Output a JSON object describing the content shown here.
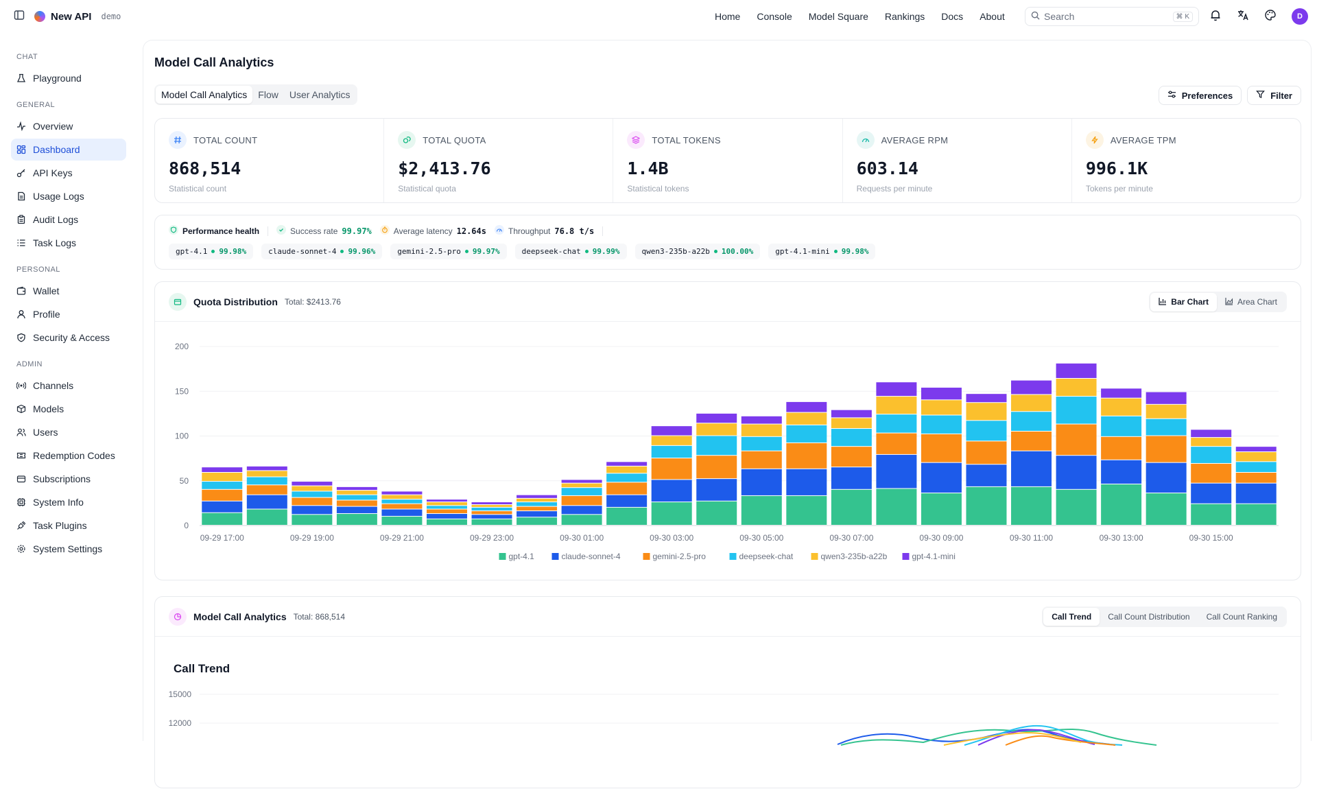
{
  "topbar": {
    "brand": "New API",
    "badge": "demo",
    "nav": [
      "Home",
      "Console",
      "Model Square",
      "Rankings",
      "Docs",
      "About"
    ],
    "search_placeholder": "Search",
    "search_shortcut": "⌘ K",
    "avatar_letter": "D"
  },
  "sidebar": {
    "sections": [
      {
        "title": "CHAT",
        "items": [
          {
            "label": "Playground",
            "icon": "flask-icon"
          }
        ]
      },
      {
        "title": "GENERAL",
        "items": [
          {
            "label": "Overview",
            "icon": "activity-icon"
          },
          {
            "label": "Dashboard",
            "icon": "grid-icon",
            "active": true
          },
          {
            "label": "API Keys",
            "icon": "key-icon"
          },
          {
            "label": "Usage Logs",
            "icon": "file-icon"
          },
          {
            "label": "Audit Logs",
            "icon": "clipboard-icon"
          },
          {
            "label": "Task Logs",
            "icon": "list-icon"
          }
        ]
      },
      {
        "title": "PERSONAL",
        "items": [
          {
            "label": "Wallet",
            "icon": "wallet-icon"
          },
          {
            "label": "Profile",
            "icon": "user-icon"
          },
          {
            "label": "Security & Access",
            "icon": "shield-icon"
          }
        ]
      },
      {
        "title": "ADMIN",
        "items": [
          {
            "label": "Channels",
            "icon": "radio-icon"
          },
          {
            "label": "Models",
            "icon": "box-icon"
          },
          {
            "label": "Users",
            "icon": "users-icon"
          },
          {
            "label": "Redemption Codes",
            "icon": "ticket-icon"
          },
          {
            "label": "Subscriptions",
            "icon": "card-icon"
          },
          {
            "label": "System Info",
            "icon": "cpu-icon"
          },
          {
            "label": "Task Plugins",
            "icon": "plug-icon"
          },
          {
            "label": "System Settings",
            "icon": "gear-icon"
          }
        ]
      }
    ]
  },
  "page": {
    "title": "Model Call Analytics",
    "tabs": [
      "Model Call Analytics",
      "Flow",
      "User Analytics"
    ],
    "preferences_label": "Preferences",
    "filter_label": "Filter"
  },
  "stats": [
    {
      "label": "TOTAL COUNT",
      "value": "868,514",
      "sub": "Statistical count",
      "icon": "hash-icon",
      "color": "#3b82f6",
      "bg": "#eaf2ff"
    },
    {
      "label": "TOTAL QUOTA",
      "value": "$2,413.76",
      "sub": "Statistical quota",
      "icon": "coins-icon",
      "color": "#10b981",
      "bg": "#e6f7f0"
    },
    {
      "label": "TOTAL TOKENS",
      "value": "1.4B",
      "sub": "Statistical tokens",
      "icon": "layers-icon",
      "color": "#d946ef",
      "bg": "#fbeafd"
    },
    {
      "label": "AVERAGE RPM",
      "value": "603.14",
      "sub": "Requests per minute",
      "icon": "gauge-icon",
      "color": "#14b8a6",
      "bg": "#e6f6f5"
    },
    {
      "label": "AVERAGE TPM",
      "value": "996.1K",
      "sub": "Tokens per minute",
      "icon": "bolt-icon",
      "color": "#f59e0b",
      "bg": "#fdf4e3"
    }
  ],
  "performance": {
    "title": "Performance health",
    "success_label": "Success rate",
    "success_value": "99.97%",
    "latency_label": "Average latency",
    "latency_value": "12.64s",
    "throughput_label": "Throughput",
    "throughput_value": "76.8 t/s",
    "models": [
      {
        "name": "gpt-4.1",
        "pct": "99.98%"
      },
      {
        "name": "claude-sonnet-4",
        "pct": "99.96%"
      },
      {
        "name": "gemini-2.5-pro",
        "pct": "99.97%"
      },
      {
        "name": "deepseek-chat",
        "pct": "99.99%"
      },
      {
        "name": "qwen3-235b-a22b",
        "pct": "100.00%"
      },
      {
        "name": "gpt-4.1-mini",
        "pct": "99.98%"
      }
    ]
  },
  "quota": {
    "title": "Quota Distribution",
    "total": "Total: $2413.76",
    "bar_label": "Bar Chart",
    "area_label": "Area Chart"
  },
  "analytics": {
    "title": "Model Call Analytics",
    "total": "Total: 868,514",
    "tabs": [
      "Call Trend",
      "Call Count Distribution",
      "Call Count Ranking"
    ],
    "chart_title": "Call Trend"
  },
  "chart_data": [
    {
      "type": "bar",
      "stacked": true,
      "ylim": [
        0,
        200
      ],
      "yticks": [
        0,
        50,
        100,
        150,
        200
      ],
      "xtick_labels": [
        "09-29 17:00",
        "09-29 19:00",
        "09-29 21:00",
        "09-29 23:00",
        "09-30 01:00",
        "09-30 03:00",
        "09-30 05:00",
        "09-30 07:00",
        "09-30 09:00",
        "09-30 11:00",
        "09-30 13:00",
        "09-30 15:00"
      ],
      "grid": true,
      "legend": "bottom",
      "categories": [
        "09-29 17:00",
        "09-29 18:00",
        "09-29 19:00",
        "09-29 20:00",
        "09-29 21:00",
        "09-29 22:00",
        "09-29 23:00",
        "09-30 00:00",
        "09-30 01:00",
        "09-30 02:00",
        "09-30 03:00",
        "09-30 04:00",
        "09-30 05:00",
        "09-30 06:00",
        "09-30 07:00",
        "09-30 08:00",
        "09-30 09:00",
        "09-30 10:00",
        "09-30 11:00",
        "09-30 12:00",
        "09-30 13:00",
        "09-30 14:00",
        "09-30 15:00",
        "09-30 16:00"
      ],
      "series": [
        {
          "name": "gpt-4.1",
          "color": "#34c38f",
          "values": [
            14,
            18,
            12,
            13,
            10,
            7,
            7,
            9,
            12,
            20,
            26,
            27,
            33,
            33,
            40,
            41,
            36,
            43,
            43,
            40,
            46,
            36,
            24,
            24
          ]
        },
        {
          "name": "claude-sonnet-4",
          "color": "#1d5bea",
          "values": [
            13,
            16,
            10,
            8,
            8,
            6,
            5,
            7,
            10,
            14,
            25,
            25,
            30,
            30,
            25,
            38,
            34,
            25,
            40,
            38,
            27,
            34,
            23,
            23
          ]
        },
        {
          "name": "gemini-2.5-pro",
          "color": "#fa8c16",
          "values": [
            13,
            11,
            9,
            7,
            6,
            5,
            4,
            5,
            11,
            14,
            24,
            26,
            20,
            29,
            23,
            24,
            32,
            26,
            22,
            35,
            26,
            30,
            22,
            12
          ]
        },
        {
          "name": "deepseek-chat",
          "color": "#22c3f0",
          "values": [
            9,
            9,
            7,
            6,
            5,
            4,
            4,
            5,
            9,
            10,
            14,
            22,
            16,
            20,
            20,
            21,
            21,
            23,
            22,
            31,
            23,
            19,
            19,
            12
          ]
        },
        {
          "name": "qwen3-235b-a22b",
          "color": "#fbc02d",
          "values": [
            10,
            7,
            6,
            5,
            5,
            4,
            3,
            4,
            5,
            8,
            11,
            14,
            14,
            14,
            12,
            20,
            17,
            20,
            19,
            20,
            20,
            16,
            10,
            11
          ]
        },
        {
          "name": "gpt-4.1-mini",
          "color": "#7c3aed",
          "values": [
            6,
            5,
            5,
            4,
            4,
            3,
            3,
            4,
            4,
            5,
            11,
            11,
            9,
            12,
            9,
            16,
            14,
            10,
            16,
            17,
            11,
            14,
            9,
            6
          ]
        }
      ]
    },
    {
      "type": "line",
      "title": "Call Trend",
      "yticks_visible": [
        15000,
        12000
      ]
    }
  ]
}
